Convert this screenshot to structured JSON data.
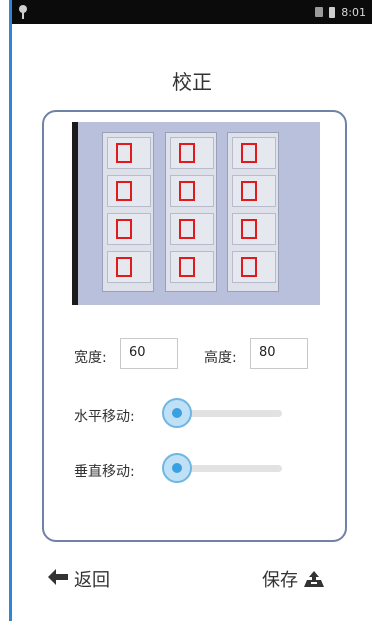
{
  "status_bar": {
    "time": "8:01"
  },
  "page": {
    "title": "校正"
  },
  "preview": {
    "panels": [
      {
        "boxes": 4
      },
      {
        "boxes": 4
      },
      {
        "boxes": 4
      }
    ]
  },
  "form": {
    "width_label": "宽度:",
    "width_value": "60",
    "height_label": "高度:",
    "height_value": "80",
    "horizontal_label": "水平移动:",
    "horizontal_value": 0,
    "vertical_label": "垂直移动:",
    "vertical_value": 0
  },
  "actions": {
    "back_label": "返回",
    "save_label": "保存"
  },
  "colors": {
    "accent_blue": "#3aa0e0",
    "card_border": "#7083a6",
    "detection_box": "#e11b1b"
  }
}
